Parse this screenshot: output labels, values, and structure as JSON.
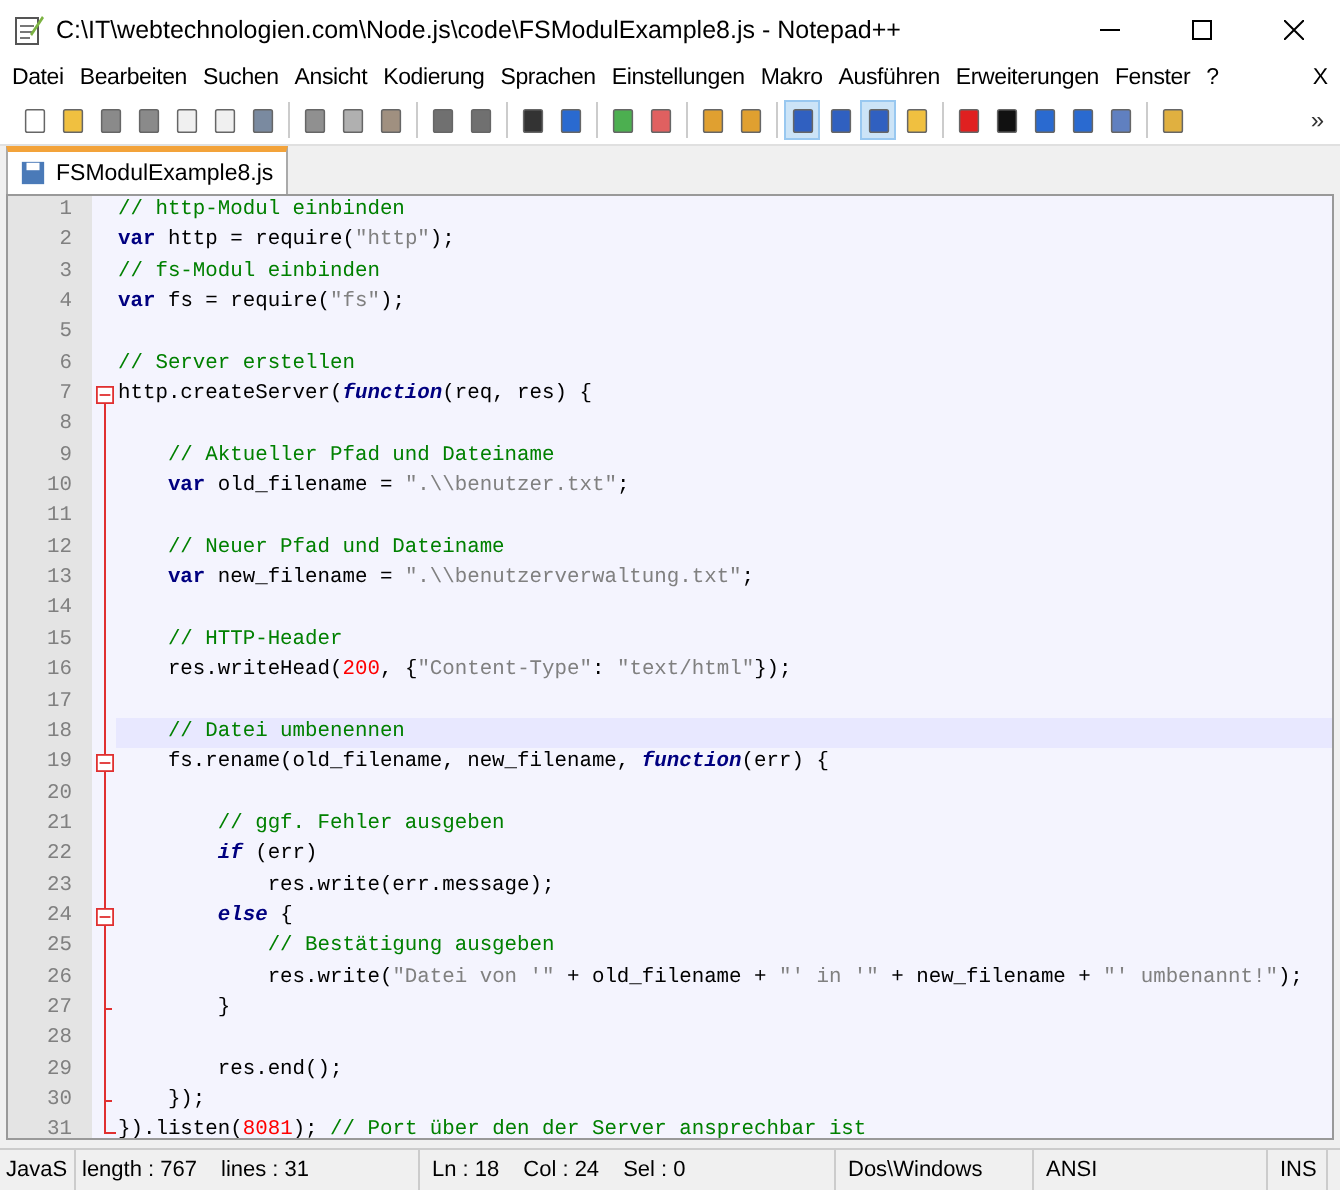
{
  "window": {
    "title": "C:\\IT\\webtechnologien.com\\Node.js\\code\\FSModulExample8.js - Notepad++"
  },
  "menu": [
    "Datei",
    "Bearbeiten",
    "Suchen",
    "Ansicht",
    "Kodierung",
    "Sprachen",
    "Einstellungen",
    "Makro",
    "Ausführen",
    "Erweiterungen",
    "Fenster",
    "?"
  ],
  "menu_close": "X",
  "toolbar": {
    "buttons": [
      {
        "pressed": false
      },
      {
        "pressed": false
      },
      {
        "pressed": false
      },
      {
        "pressed": false
      },
      {
        "pressed": false
      },
      {
        "pressed": false
      },
      {
        "pressed": false
      },
      {
        "pressed": false
      },
      {
        "pressed": false
      },
      {
        "pressed": false
      },
      {
        "pressed": false
      },
      {
        "pressed": false
      },
      {
        "pressed": false
      },
      {
        "pressed": false
      },
      {
        "pressed": false
      },
      {
        "pressed": false
      },
      {
        "pressed": false
      },
      {
        "pressed": false
      },
      {
        "pressed": true
      },
      {
        "pressed": false
      },
      {
        "pressed": true
      },
      {
        "pressed": false
      },
      {
        "pressed": false
      },
      {
        "pressed": false
      },
      {
        "pressed": false
      },
      {
        "pressed": false
      },
      {
        "pressed": false
      },
      {
        "pressed": false
      }
    ],
    "overflow": "»"
  },
  "tabs": [
    {
      "label": "FSModulExample8.js",
      "selected": true
    }
  ],
  "editor": {
    "lines": [
      {
        "number": "1",
        "kind": "plain",
        "current": false,
        "tokens": [
          {
            "kind": "comment",
            "text": "// http-Modul einbinden"
          }
        ]
      },
      {
        "number": "2",
        "kind": "plain",
        "current": false,
        "tokens": [
          {
            "kind": "keyword",
            "text": "var"
          },
          {
            "kind": "plain",
            "text": " http = require("
          },
          {
            "kind": "string",
            "text": "\"http\""
          },
          {
            "kind": "plain",
            "text": ");"
          }
        ]
      },
      {
        "number": "3",
        "kind": "plain",
        "current": false,
        "tokens": [
          {
            "kind": "comment",
            "text": "// fs-Modul einbinden"
          }
        ]
      },
      {
        "number": "4",
        "kind": "plain",
        "current": false,
        "tokens": [
          {
            "kind": "keyword",
            "text": "var"
          },
          {
            "kind": "plain",
            "text": " fs = require("
          },
          {
            "kind": "string",
            "text": "\"fs\""
          },
          {
            "kind": "plain",
            "text": ");"
          }
        ]
      },
      {
        "number": "5",
        "kind": "plain",
        "current": false
      },
      {
        "number": "6",
        "kind": "plain",
        "current": false,
        "tokens": [
          {
            "kind": "comment",
            "text": "// Server erstellen"
          }
        ]
      },
      {
        "number": "7",
        "kind": "fold-start",
        "current": false,
        "tokens": [
          {
            "kind": "plain",
            "text": "http.createServer("
          },
          {
            "kind": "italic",
            "text": "function"
          },
          {
            "kind": "plain",
            "text": "(req, res) {"
          }
        ]
      },
      {
        "number": "8",
        "kind": "fold-body",
        "current": false
      },
      {
        "number": "9",
        "kind": "fold-body",
        "current": false,
        "tokens": [
          {
            "kind": "comment",
            "text": "    // Aktueller Pfad und Dateiname"
          }
        ]
      },
      {
        "number": "10",
        "kind": "fold-body",
        "current": false,
        "tokens": [
          {
            "kind": "keyword",
            "text": "    var"
          },
          {
            "kind": "plain",
            "text": " old_filename = "
          },
          {
            "kind": "string",
            "text": "\".\\\\benutzer.txt\""
          },
          {
            "kind": "plain",
            "text": ";"
          }
        ]
      },
      {
        "number": "11",
        "kind": "fold-body",
        "current": false
      },
      {
        "number": "12",
        "kind": "fold-body",
        "current": false,
        "tokens": [
          {
            "kind": "comment",
            "text": "    // Neuer Pfad und Dateiname"
          }
        ]
      },
      {
        "number": "13",
        "kind": "fold-body",
        "current": false,
        "tokens": [
          {
            "kind": "keyword",
            "text": "    var"
          },
          {
            "kind": "plain",
            "text": " new_filename = "
          },
          {
            "kind": "string",
            "text": "\".\\\\benutzerverwaltung.txt\""
          },
          {
            "kind": "plain",
            "text": ";"
          }
        ]
      },
      {
        "number": "14",
        "kind": "fold-body",
        "current": false
      },
      {
        "number": "15",
        "kind": "fold-body",
        "current": false,
        "tokens": [
          {
            "kind": "comment",
            "text": "    // HTTP-Header"
          }
        ]
      },
      {
        "number": "16",
        "kind": "fold-body",
        "current": false,
        "tokens": [
          {
            "kind": "plain",
            "text": "    res.writeHead("
          },
          {
            "kind": "number",
            "text": "200"
          },
          {
            "kind": "plain",
            "text": ", {"
          },
          {
            "kind": "string",
            "text": "\"Content-Type\""
          },
          {
            "kind": "plain",
            "text": ": "
          },
          {
            "kind": "string",
            "text": "\"text/html\""
          },
          {
            "kind": "plain",
            "text": "});"
          }
        ]
      },
      {
        "number": "17",
        "kind": "fold-body",
        "current": false
      },
      {
        "number": "18",
        "kind": "fold-body",
        "current": true,
        "tokens": [
          {
            "kind": "comment",
            "text": "    // Datei umbenennen"
          }
        ]
      },
      {
        "number": "19",
        "kind": "fold-start",
        "current": false,
        "tokens": [
          {
            "kind": "plain",
            "text": "    fs.rename(old_filename, new_filename, "
          },
          {
            "kind": "italic",
            "text": "function"
          },
          {
            "kind": "plain",
            "text": "(err) {"
          }
        ]
      },
      {
        "number": "20",
        "kind": "fold-body",
        "current": false
      },
      {
        "number": "21",
        "kind": "fold-body",
        "current": false,
        "tokens": [
          {
            "kind": "comment",
            "text": "        // ggf. Fehler ausgeben"
          }
        ]
      },
      {
        "number": "22",
        "kind": "fold-body",
        "current": false,
        "tokens": [
          {
            "kind": "italic",
            "text": "        if"
          },
          {
            "kind": "plain",
            "text": " (err)"
          }
        ]
      },
      {
        "number": "23",
        "kind": "fold-body",
        "current": false,
        "tokens": [
          {
            "kind": "plain",
            "text": "            res.write(err.message);"
          }
        ]
      },
      {
        "number": "24",
        "kind": "fold-start",
        "current": false,
        "tokens": [
          {
            "kind": "italic",
            "text": "        else"
          },
          {
            "kind": "plain",
            "text": " {"
          }
        ]
      },
      {
        "number": "25",
        "kind": "fold-body",
        "current": false,
        "tokens": [
          {
            "kind": "comment",
            "text": "            // Bestätigung ausgeben"
          }
        ]
      },
      {
        "number": "26",
        "kind": "fold-body",
        "current": false,
        "tokens": [
          {
            "kind": "plain",
            "text": "            res.write("
          },
          {
            "kind": "string",
            "text": "\"Datei von '\""
          },
          {
            "kind": "plain",
            "text": " + old_filename + "
          },
          {
            "kind": "string",
            "text": "\"' in '\""
          },
          {
            "kind": "plain",
            "text": " + new_filename + "
          },
          {
            "kind": "string",
            "text": "\"' umbenannt!\""
          },
          {
            "kind": "plain",
            "text": ");"
          }
        ]
      },
      {
        "number": "27",
        "kind": "fold-inner-end",
        "current": false,
        "tokens": [
          {
            "kind": "plain",
            "text": "        }"
          }
        ]
      },
      {
        "number": "28",
        "kind": "fold-body",
        "current": false
      },
      {
        "number": "29",
        "kind": "fold-body",
        "current": false,
        "tokens": [
          {
            "kind": "plain",
            "text": "        res.end();"
          }
        ]
      },
      {
        "number": "30",
        "kind": "fold-inner-end",
        "current": false,
        "tokens": [
          {
            "kind": "plain",
            "text": "    });"
          }
        ]
      },
      {
        "number": "31",
        "kind": "fold-end",
        "current": false,
        "tokens": [
          {
            "kind": "plain",
            "text": "}).listen("
          },
          {
            "kind": "number",
            "text": "8081"
          },
          {
            "kind": "plain",
            "text": "); "
          },
          {
            "kind": "comment",
            "text": "// Port über den der Server ansprechbar ist"
          }
        ]
      }
    ]
  },
  "status_bar": {
    "language": "JavaS",
    "length": "length : 767",
    "lines": "lines : 31",
    "ln": "Ln : 18",
    "col": "Col : 24",
    "sel": "Sel : 0",
    "eol": "Dos\\Windows",
    "encoding": "ANSI",
    "mode": "INS"
  }
}
